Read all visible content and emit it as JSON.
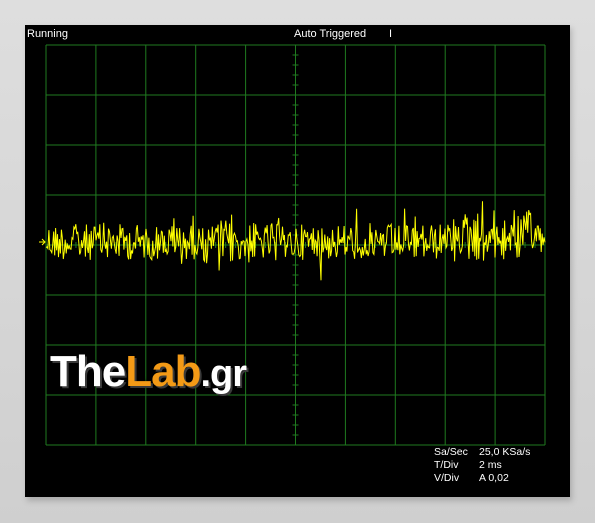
{
  "status_bar": {
    "run_state": "Running",
    "trigger_mode": "Auto Triggered",
    "cursor_mark": "I"
  },
  "readout": {
    "sample_rate_label": "Sa/Sec",
    "sample_rate_value": "25,0 KSa/s",
    "time_div_label": "T/Div",
    "time_div_value": "2 ms",
    "volt_div_label": "V/Div",
    "volt_div_value": "A 0,02"
  },
  "watermark": {
    "text_the": "The",
    "text_lab": "Lab",
    "text_gr": ".gr"
  },
  "colors": {
    "screen_bg": "#000000",
    "grid": "#1f7a1f",
    "trace": "#ffff00",
    "text": "#ffffff",
    "logo_accent": "#f39a16"
  },
  "chart_data": {
    "type": "line",
    "grid_divisions": {
      "x": 10,
      "y": 8
    },
    "ground_marker": "channel A",
    "series": [
      {
        "values": []
      }
    ]
  }
}
